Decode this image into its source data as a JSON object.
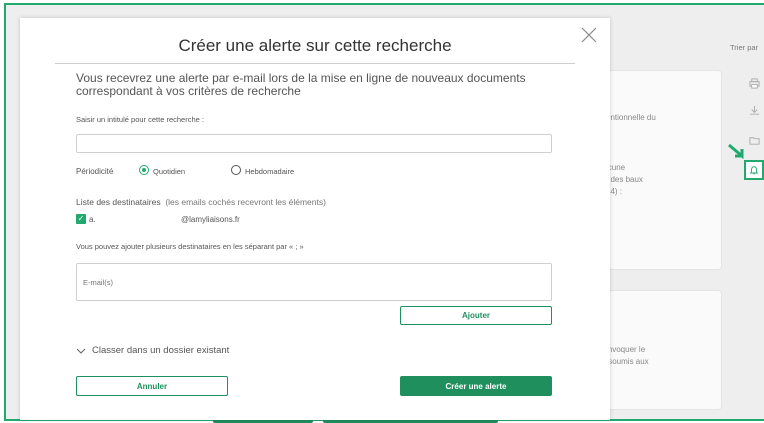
{
  "background": {
    "sort_label": "Trier par",
    "snippet_1": "entionnelle du",
    "snippet_2": "icune\nt des baux\n44) :",
    "snippet_3": "invoquer le\n soumis aux"
  },
  "modal": {
    "title": "Créer une alerte sur cette recherche",
    "intro": "Vous recevrez une alerte par e-mail lors de la mise en ligne de nouveaux documents correspondant à vos critères de recherche",
    "title_field_label": "Saisir un intitulé pour cette recherche :",
    "title_field_value": "",
    "periodicity": {
      "label": "Périodicité",
      "options": [
        "Quotidien",
        "Hebdomadaire"
      ],
      "selected": "Quotidien"
    },
    "recipients": {
      "heading": "Liste des destinataires",
      "heading_note": "(les emails cochés recevront les éléments)",
      "items": [
        {
          "local_part": "a.",
          "domain": "@lamyliaisons.fr",
          "checked": true
        }
      ]
    },
    "add_hint": "Vous pouvez ajouter plusieurs destinataires en les séparant par « ; »",
    "email_placeholder": "E-mail(s)",
    "add_button": "Ajouter",
    "folder_toggle": "Classer dans un dossier existant",
    "cancel_button": "Annuler",
    "create_button": "Créer une alerte"
  },
  "colors": {
    "accent": "#22aa6e",
    "button_green": "#1f8f5e"
  },
  "icons": [
    "close-icon",
    "chevron-down-icon",
    "checkbox-checked-icon",
    "print-icon",
    "download-icon",
    "folder-icon",
    "bell-icon",
    "arrow-pointer-icon"
  ]
}
